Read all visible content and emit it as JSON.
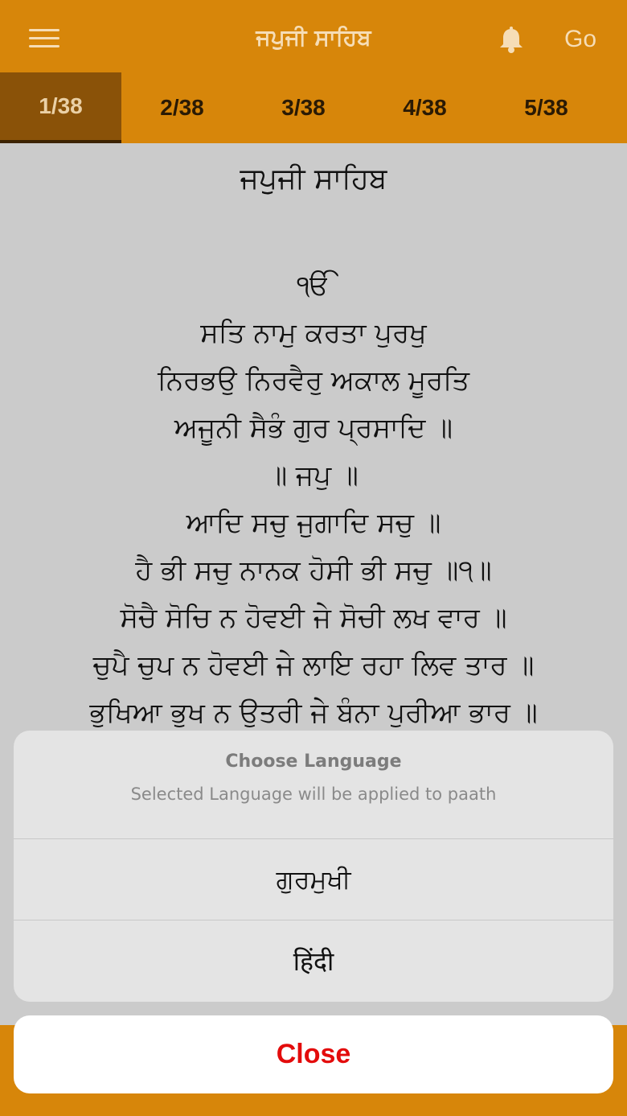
{
  "header": {
    "title": "ਜਪੁਜੀ ਸਾਹਿਬ",
    "go_label": "Go",
    "menu_icon": "hamburger-menu-icon",
    "bell_icon": "bell-icon"
  },
  "tabs": [
    {
      "label": "1/38",
      "active": true
    },
    {
      "label": "2/38",
      "active": false
    },
    {
      "label": "3/38",
      "active": false
    },
    {
      "label": "4/38",
      "active": false
    },
    {
      "label": "5/38",
      "active": false
    }
  ],
  "content": {
    "paath_title": "ਜਪੁਜੀ ਸਾਹਿਬ",
    "verses": [
      "ੴ",
      "ਸਤਿ ਨਾਮੁ ਕਰਤਾ ਪੁਰਖੁ",
      "ਨਿਰਭਉ ਨਿਰਵੈਰੁ ਅਕਾਲ ਮੂਰਤਿ",
      "ਅਜੂਨੀ ਸੈਭੰ ਗੁਰ ਪ੍ਰਸਾਦਿ ॥",
      "॥ ਜਪੁ ॥",
      "ਆਦਿ ਸਚੁ ਜੁਗਾਦਿ ਸਚੁ ॥",
      "ਹੈ ਭੀ ਸਚੁ ਨਾਨਕ ਹੋਸੀ ਭੀ ਸਚੁ ॥੧॥",
      "ਸੋਚੈ ਸੋਚਿ ਨ ਹੋਵਈ ਜੇ ਸੋਚੀ ਲਖ ਵਾਰ ॥",
      "ਚੁਪੈ ਚੁਪ ਨ ਹੋਵਈ ਜੇ ਲਾਇ ਰਹਾ ਲਿਵ ਤਾਰ ॥",
      "ਭੁਖਿਆ ਭੁਖ ਨ ਉਤਰੀ ਜੇ ਬੰਨਾ ਪੁਰੀਆ ਭਾਰ ॥"
    ]
  },
  "action_sheet": {
    "title": "Choose Language",
    "subtitle": "Selected Language will be applied to paath",
    "options": [
      "ਗੁਰਮੁਖੀ",
      "हिंदी"
    ],
    "close_label": "Close"
  },
  "colors": {
    "accent": "#d7860a",
    "active_tab": "#8a5208",
    "close_text": "#e30b0b"
  }
}
